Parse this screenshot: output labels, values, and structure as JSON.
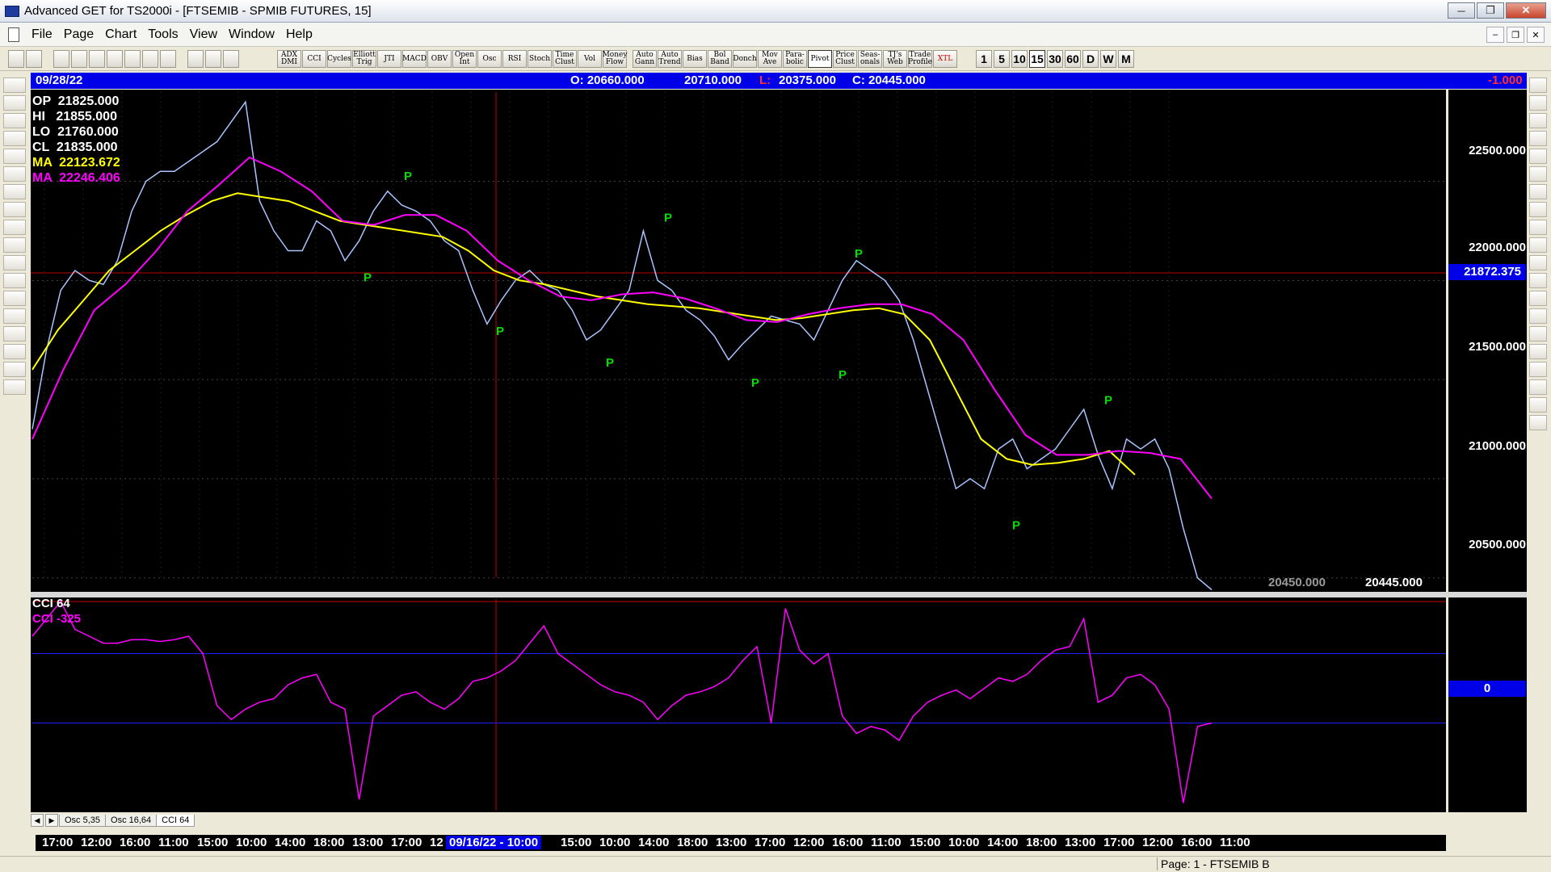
{
  "window": {
    "title": "Advanced GET for TS2000i - [FTSEMIB - SPMIB FUTURES, 15]"
  },
  "menu": [
    "File",
    "Page",
    "Chart",
    "Tools",
    "View",
    "Window",
    "Help"
  ],
  "toolbar": {
    "indicators": [
      "ADX DMI",
      "CCI",
      "Cycles",
      "Elliott Trig",
      "JTI",
      "MACD",
      "OBV",
      "Open Int",
      "Osc",
      "RSI",
      "Stoch",
      "Time Clust",
      "Vol",
      "Money Flow",
      "Auto Gann",
      "Auto Trend",
      "Bias",
      "Bol Band",
      "Donch",
      "Mov Ave",
      "Para- bolic",
      "Pivot",
      "Price Clust",
      "Seas- onals",
      "TJ's Web",
      "Trade Profile",
      "XTL"
    ],
    "timeframes": [
      "1",
      "5",
      "10",
      "15",
      "30",
      "60",
      "D",
      "W",
      "M"
    ]
  },
  "left_tools": [
    "open",
    "elliott",
    "reset",
    "study",
    "elliott",
    "up",
    "down",
    "left",
    "right",
    "squeeze",
    "expand",
    "compress",
    "select",
    "lines",
    "gann",
    "fib",
    "cross",
    "print"
  ],
  "right_tools": [
    "close",
    "pen",
    "line",
    "fib-ret",
    "fib-ext",
    "fib-time",
    "arc",
    "fan",
    "rect",
    "ellipse",
    "channel",
    "pti",
    "grid",
    "mob",
    "text",
    "zoom",
    "marker",
    "stat",
    "book",
    "magnet"
  ],
  "info_bar": {
    "date": "09/28/22",
    "open": "O: 20660.000",
    "high": "20710.000",
    "low_label": "L:",
    "low": "20375.000",
    "close": "C: 20445.000",
    "change": "-1.000"
  },
  "ohlc_panel": {
    "op": "OP  21825.000",
    "hi": "HI   21855.000",
    "lo": "LO  21760.000",
    "cl": "CL  21835.000",
    "ma1": "MA  22123.672",
    "ma2": "MA  22246.406"
  },
  "price_axis": [
    "22500.000",
    "22000.000",
    "21500.000",
    "21000.000",
    "20500.000"
  ],
  "current_price": "21872.375",
  "last_values": {
    "a": "20450.000",
    "b": "20445.000"
  },
  "cci_panel": {
    "title": "CCI 64",
    "label": "CCI  -325",
    "zero": "0"
  },
  "tabs": [
    "Osc 5,35",
    "Osc 16,64",
    "CCI 64"
  ],
  "time_axis": [
    "17:00",
    "12:00",
    "16:00",
    "11:00",
    "15:00",
    "10:00",
    "14:00",
    "18:00",
    "13:00",
    "17:00",
    "12",
    "09/16/22 - 10:00",
    "15:00",
    "10:00",
    "14:00",
    "18:00",
    "13:00",
    "17:00",
    "12:00",
    "16:00",
    "11:00",
    "15:00",
    "10:00",
    "14:00",
    "18:00",
    "13:00",
    "17:00",
    "12:00",
    "16:00",
    "11:00"
  ],
  "pivot_label": "P",
  "statusbar": {
    "page": "Page: 1 - FTSEMIB B"
  },
  "colors": {
    "background": "#000000",
    "price": "#a8c4ff",
    "ma_fast": "#ffff00",
    "ma_slow": "#ff00ff",
    "pivot": "#00e000",
    "infobar": "#0000e8"
  },
  "chart_data": {
    "type": "line",
    "title": "FTSEMIB - SPMIB FUTURES, 15",
    "ylim": [
      20450,
      22950
    ],
    "y_ticks": [
      20500,
      21000,
      21500,
      22000,
      22500
    ],
    "series": [
      {
        "name": "Close",
        "values": [
          21250,
          21650,
          21950,
          22050,
          22000,
          21980,
          22100,
          22350,
          22500,
          22550,
          22550,
          22600,
          22650,
          22700,
          22800,
          22900,
          22400,
          22250,
          22150,
          22150,
          22300,
          22250,
          22100,
          22200,
          22350,
          22450,
          22380,
          22350,
          22300,
          22200,
          22150,
          21950,
          21780,
          21900,
          22000,
          22050,
          21980,
          21950,
          21850,
          21700,
          21750,
          21850,
          21950,
          22250,
          22000,
          21950,
          21850,
          21800,
          21720,
          21600,
          21680,
          21750,
          21820,
          21800,
          21780,
          21700,
          21850,
          22000,
          22100,
          22050,
          22000,
          21900,
          21700,
          21450,
          21200,
          20950,
          21000,
          20950,
          21150,
          21200,
          21050,
          21100,
          21150,
          21250,
          21350,
          21120,
          20950,
          21200,
          21150,
          21200,
          21050,
          20750,
          20500,
          20440
        ]
      },
      {
        "name": "MA",
        "values": [
          21550,
          21750,
          21900,
          22050,
          22150,
          22250,
          22330,
          22400,
          22440,
          22420,
          22400,
          22350,
          22300,
          22280,
          22260,
          22240,
          22220,
          22150,
          22050,
          22000,
          21980,
          21950,
          21920,
          21900,
          21880,
          21870,
          21860,
          21840,
          21820,
          21800,
          21810,
          21830,
          21850,
          21860,
          21830,
          21700,
          21450,
          21200,
          21100,
          21070,
          21080,
          21100,
          21140,
          21020
        ]
      },
      {
        "name": "MA",
        "values": [
          21200,
          21550,
          21850,
          21980,
          22150,
          22350,
          22480,
          22620,
          22550,
          22450,
          22300,
          22280,
          22330,
          22330,
          22250,
          22100,
          22000,
          21920,
          21900,
          21930,
          21940,
          21910,
          21860,
          21800,
          21790,
          21830,
          21860,
          21880,
          21880,
          21830,
          21700,
          21450,
          21220,
          21120,
          21120,
          21140,
          21130,
          21100,
          20900
        ]
      }
    ],
    "pivots": [
      {
        "label": "P",
        "kind": "low",
        "value": 22060
      },
      {
        "label": "P",
        "kind": "high",
        "value": 22490
      },
      {
        "label": "P",
        "kind": "low",
        "value": 21790
      },
      {
        "label": "P",
        "kind": "low",
        "value": 21630
      },
      {
        "label": "P",
        "kind": "high",
        "value": 22280
      },
      {
        "label": "P",
        "kind": "low",
        "value": 21530
      },
      {
        "label": "P",
        "kind": "low",
        "value": 21570
      },
      {
        "label": "P",
        "kind": "high",
        "value": 22100
      },
      {
        "label": "P",
        "kind": "low",
        "value": 20810
      },
      {
        "label": "P",
        "kind": "high",
        "value": 21360
      }
    ],
    "cci": {
      "name": "CCI 64",
      "ylim": [
        -350,
        250
      ],
      "values": [
        150,
        200,
        250,
        170,
        150,
        130,
        130,
        140,
        140,
        135,
        140,
        150,
        100,
        -50,
        -90,
        -60,
        -40,
        -30,
        10,
        30,
        40,
        -40,
        -60,
        -320,
        -80,
        -50,
        -20,
        -10,
        -40,
        -60,
        -30,
        20,
        30,
        50,
        80,
        130,
        180,
        100,
        70,
        40,
        10,
        -10,
        -20,
        -40,
        -90,
        -50,
        -20,
        -10,
        5,
        30,
        80,
        120,
        -100,
        230,
        110,
        70,
        100,
        -80,
        -130,
        -110,
        -120,
        -150,
        -80,
        -40,
        -20,
        -5,
        -30,
        0,
        30,
        20,
        40,
        80,
        110,
        120,
        200,
        -40,
        -20,
        30,
        40,
        10,
        -60,
        -330,
        -110,
        -100
      ]
    }
  }
}
